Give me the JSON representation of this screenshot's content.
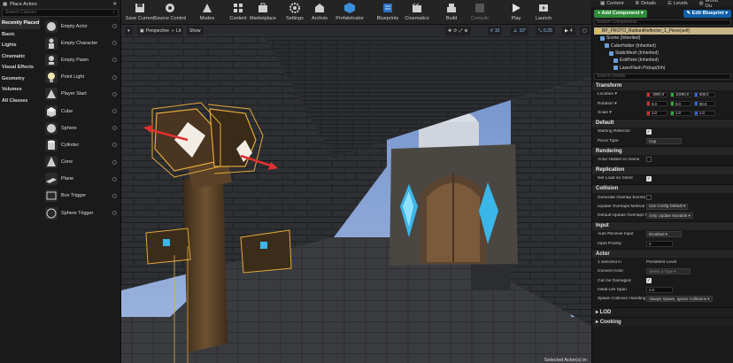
{
  "toolbar": {
    "buttons": [
      {
        "label": "Save Current",
        "icon": "save-icon"
      },
      {
        "label": "Source Control",
        "icon": "source-control-icon"
      },
      {
        "label": "Modes",
        "icon": "modes-icon"
      },
      {
        "label": "Content",
        "icon": "content-icon"
      },
      {
        "label": "Marketplace",
        "icon": "marketplace-icon"
      },
      {
        "label": "Settings",
        "icon": "gear-icon"
      },
      {
        "label": "Blueprints",
        "icon": "blueprint-icon"
      },
      {
        "label": "Cinematics",
        "icon": "cinematics-icon"
      },
      {
        "label": "Build",
        "icon": "build-icon"
      },
      {
        "label": "Compile",
        "icon": "compile-icon"
      },
      {
        "label": "Play",
        "icon": "play-icon"
      },
      {
        "label": "Launch",
        "icon": "launch-icon"
      }
    ],
    "archvis_label": "Archvis",
    "prefabricator_label": "Prefabricator"
  },
  "place_actors": {
    "tab_label": "Place Actors",
    "search_placeholder": "Search Classes",
    "categories": [
      "Recently Placed",
      "Basic",
      "Lights",
      "Cinematic",
      "Visual Effects",
      "Geometry",
      "Volumes",
      "All Classes"
    ],
    "items": [
      {
        "label": "Empty Actor",
        "icon": "sphere-icon"
      },
      {
        "label": "Empty Character",
        "icon": "character-icon"
      },
      {
        "label": "Empty Pawn",
        "icon": "pawn-icon"
      },
      {
        "label": "Point Light",
        "icon": "light-bulb-icon"
      },
      {
        "label": "Player Start",
        "icon": "player-start-icon"
      },
      {
        "label": "Cube",
        "icon": "cube-icon"
      },
      {
        "label": "Sphere",
        "icon": "sphere-icon"
      },
      {
        "label": "Cylinder",
        "icon": "cylinder-icon"
      },
      {
        "label": "Cone",
        "icon": "cone-icon"
      },
      {
        "label": "Plane",
        "icon": "plane-icon"
      },
      {
        "label": "Box Trigger",
        "icon": "box-trigger-icon"
      },
      {
        "label": "Sphere Trigger",
        "icon": "sphere-trigger-icon"
      }
    ]
  },
  "viewport": {
    "perspective_label": "Perspective",
    "lit_label": "Lit",
    "show_label": "Show",
    "grid_snap": "10",
    "rotation_snap": "10°",
    "scale_snap": "0.25",
    "camera_speed": "4",
    "selected_text": "Selected Actor(s) in:"
  },
  "right_tabs": [
    "Content",
    "Details",
    "Levels",
    "World Ou"
  ],
  "details": {
    "add_component_label": "+ Add Component ▾",
    "edit_blueprint_label": "✎ Edit Blueprint ▾",
    "search_components_placeholder": "Search Components",
    "tree": [
      {
        "label": "BP_PROTO_RadiantReflector_1_Piece(self)",
        "selected": true,
        "indent": 0
      },
      {
        "label": "Scene (Inherited)",
        "indent": 1
      },
      {
        "label": "CubeHolder (Inherited)",
        "indent": 2
      },
      {
        "label": "StaticMesh (Inherited)",
        "indent": 3
      },
      {
        "label": "ExitPoint (Inherited)",
        "indent": 4
      },
      {
        "label": "LaserFlash Pickup(Inh)",
        "indent": 4
      }
    ],
    "search_details_placeholder": "Search Details",
    "transform": {
      "title": "Transform",
      "location_label": "Location ▾",
      "location": [
        "-3000.0",
        "10290.0",
        "600.0"
      ],
      "rotation_label": "Rotation ▾",
      "rotation": [
        "0.0",
        "0.0",
        "90.0"
      ],
      "scale_label": "Scale ▾",
      "scale": [
        "1.0",
        "1.0",
        "1.0"
      ]
    },
    "default": {
      "title": "Default",
      "starting_reflector_label": "Starting Reflector",
      "piece_type_label": "Piece Type",
      "piece_type_value": "Cap"
    },
    "rendering": {
      "title": "Rendering",
      "hidden_label": "Actor Hidden In Game"
    },
    "replication": {
      "title": "Replication",
      "net_load_label": "Net Load on Client"
    },
    "collision": {
      "title": "Collision",
      "overlap_events_label": "Generate Overlap Events D",
      "update_method_label": "Update Overlaps Method D",
      "update_method_value": "Use Config Default ▾",
      "default_update_label": "Default Update Overlaps M",
      "default_update_value": "Only Update Movable ▾"
    },
    "input": {
      "title": "Input",
      "auto_receive_label": "Auto Receive Input",
      "auto_receive_value": "Disabled ▾",
      "priority_label": "Input Priority",
      "priority_value": "0"
    },
    "actor": {
      "title": "Actor",
      "selected_in_label": "1 selected in",
      "selected_in_value": "Persistent Level",
      "convert_label": "Convert Actor",
      "convert_value": "Select a Type ▾",
      "can_be_damaged_label": "Can be Damaged",
      "life_span_label": "Initial Life Span",
      "life_span_value": "0.0",
      "spawn_handling_label": "Spawn Collision Handling M",
      "spawn_handling_value": "Always Spawn, Ignore Collisions ▾"
    },
    "lod_title": "LOD",
    "cooking_title": "Cooking"
  }
}
